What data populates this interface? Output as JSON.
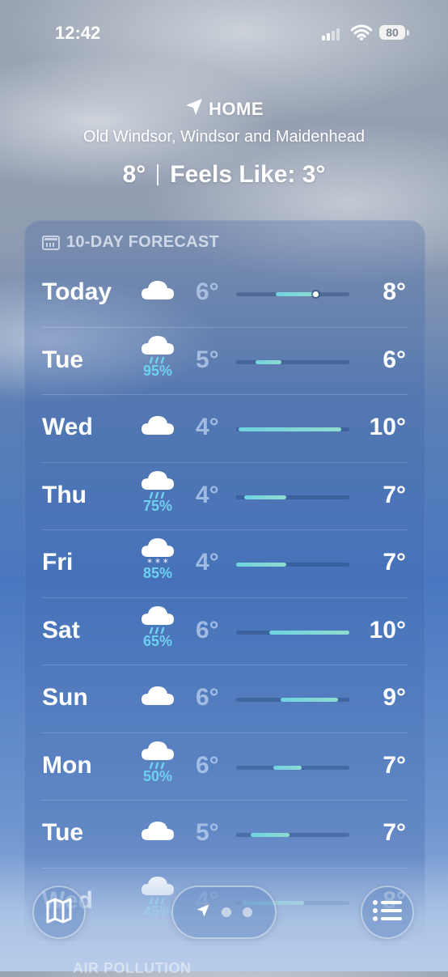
{
  "status_bar": {
    "time": "12:42",
    "battery": "80"
  },
  "location": {
    "title": "HOME",
    "subtitle": "Old Windsor, Windsor and Maidenhead",
    "current_temp": "8°",
    "feels_like": "Feels Like: 3°"
  },
  "forecast": {
    "header": "10-DAY FORECAST",
    "days": [
      {
        "day": "Today",
        "icon": "cloud-icon",
        "precip": "",
        "low": "6°",
        "high": "8°",
        "bar_start": 0.35,
        "bar_end": 0.72,
        "current_pos": 0.7
      },
      {
        "day": "Tue",
        "icon": "rain-cloud-icon",
        "precip": "95%",
        "low": "5°",
        "high": "6°",
        "bar_start": 0.17,
        "bar_end": 0.4
      },
      {
        "day": "Wed",
        "icon": "cloud-icon",
        "precip": "",
        "low": "4°",
        "high": "10°",
        "bar_start": 0.02,
        "bar_end": 0.93
      },
      {
        "day": "Thu",
        "icon": "rain-cloud-icon",
        "precip": "75%",
        "low": "4°",
        "high": "7°",
        "bar_start": 0.07,
        "bar_end": 0.44
      },
      {
        "day": "Fri",
        "icon": "snow-cloud-icon",
        "precip": "85%",
        "low": "4°",
        "high": "7°",
        "bar_start": 0.0,
        "bar_end": 0.44
      },
      {
        "day": "Sat",
        "icon": "rain-cloud-icon",
        "precip": "65%",
        "low": "6°",
        "high": "10°",
        "bar_start": 0.29,
        "bar_end": 1.0
      },
      {
        "day": "Sun",
        "icon": "cloud-icon",
        "precip": "",
        "low": "6°",
        "high": "9°",
        "bar_start": 0.39,
        "bar_end": 0.9
      },
      {
        "day": "Mon",
        "icon": "rain-cloud-icon",
        "precip": "50%",
        "low": "6°",
        "high": "7°",
        "bar_start": 0.33,
        "bar_end": 0.58
      },
      {
        "day": "Tue",
        "icon": "cloud-icon",
        "precip": "",
        "low": "5°",
        "high": "7°",
        "bar_start": 0.13,
        "bar_end": 0.47
      },
      {
        "day": "Wed",
        "icon": "rain-cloud-icon",
        "precip": "45%",
        "low": "4°",
        "high": "8°",
        "bar_start": 0.05,
        "bar_end": 0.6
      }
    ]
  },
  "next_section": "AIR POLLUTION",
  "toolbar": {
    "map": "map-icon",
    "location": "location-arrow-icon",
    "list": "list-icon"
  }
}
